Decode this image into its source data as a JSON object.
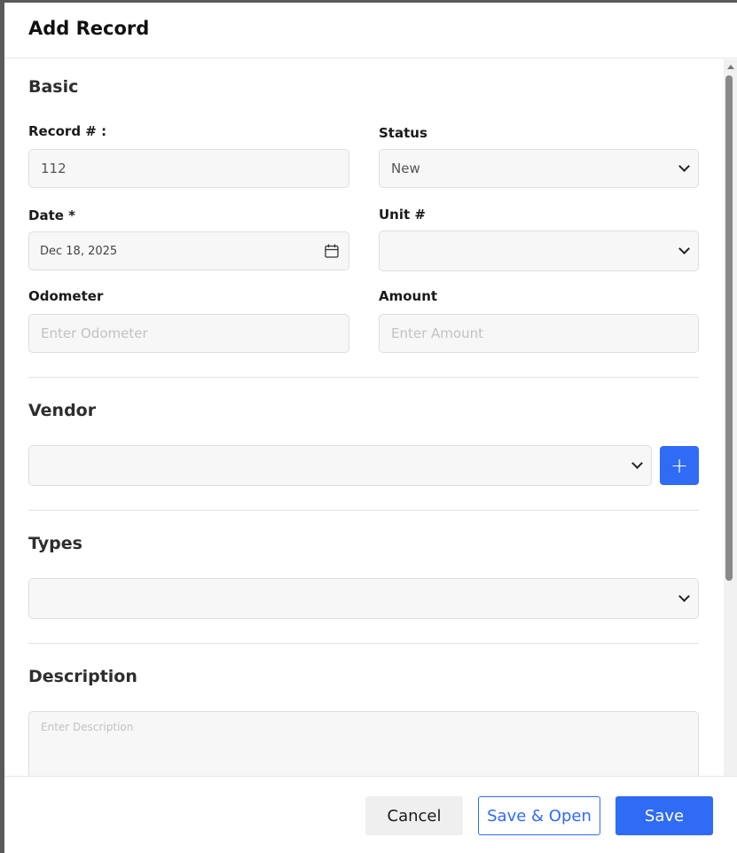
{
  "modal": {
    "title": "Add Record"
  },
  "sections": {
    "basic": "Basic",
    "vendor": "Vendor",
    "types": "Types",
    "description": "Description"
  },
  "fields": {
    "record_label": "Record # :",
    "record_value": "112",
    "status_label": "Status",
    "status_value": "New",
    "date_label": "Date *",
    "date_value": "Dec 18, 2025",
    "unit_label": "Unit #",
    "unit_value": "",
    "odometer_label": "Odometer",
    "odometer_placeholder": "Enter Odometer",
    "amount_label": "Amount",
    "amount_placeholder": "Enter Amount",
    "vendor_value": "",
    "types_value": "",
    "description_placeholder": "Enter Description"
  },
  "buttons": {
    "add_vendor": "+",
    "cancel": "Cancel",
    "save_open": "Save & Open",
    "save": "Save"
  },
  "colors": {
    "accent": "#2f6bf5"
  },
  "icons": {
    "date_picker": "calendar-icon",
    "select": "chevron-down-icon"
  }
}
